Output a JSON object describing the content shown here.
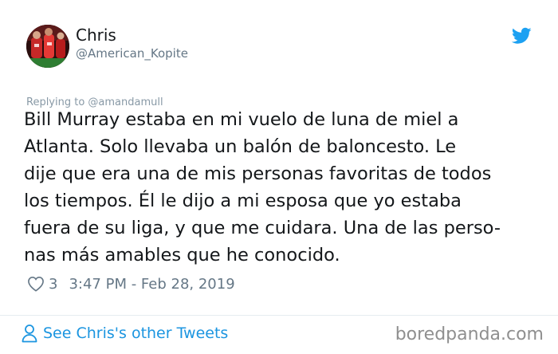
{
  "author": {
    "display_name": "Chris",
    "handle": "@American_Kopite",
    "avatar_icon": "profile-photo"
  },
  "brand_icon": "twitter-bird-icon",
  "colors": {
    "twitter_blue": "#1da1f2",
    "link_blue": "#1b95e0",
    "muted_text": "#657786"
  },
  "tweet": {
    "replying_to": "Replying to @amandamull",
    "text": "Bill Murray estaba en mi vuelo de luna de miel a\nAtlanta. Solo llevaba un balón de baloncesto. Le\ndije que era una de mis personas favoritas de todos\nlos tiempos. Él le dijo a mi esposa que yo estaba\nfuera de su liga, y que me cuidara. Una de las perso-\nnas más amables que he conocido.",
    "likes": "3",
    "timestamp": "3:47 PM - Feb 28, 2019"
  },
  "footer": {
    "other_tweets_label": "See Chris's other Tweets",
    "watermark": "boredpanda.com"
  }
}
